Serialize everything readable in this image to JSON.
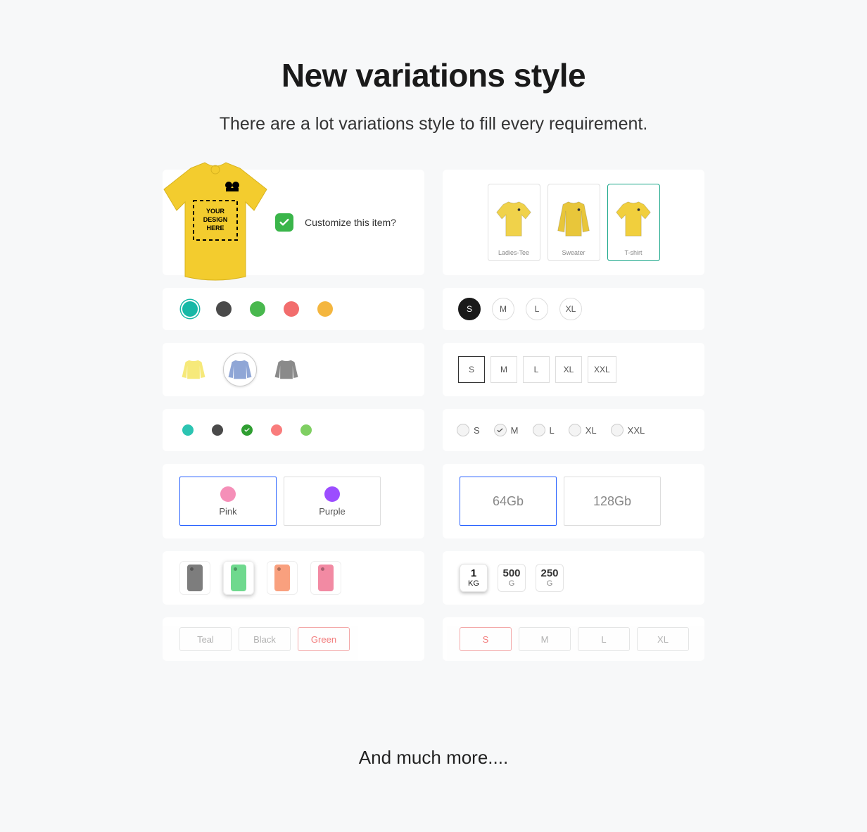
{
  "title": "New variations style",
  "subtitle": "There are a lot variations style to fill every requirement.",
  "footer": "And much more....",
  "customize": {
    "label": "Customize this item?",
    "tshirt_placeholder_line1": "YOUR",
    "tshirt_placeholder_line2": "DESIGN",
    "tshirt_placeholder_line3": "HERE"
  },
  "products": [
    {
      "label": "Ladies-Tee",
      "selected": false,
      "color": "#f0d24a",
      "type": "tee"
    },
    {
      "label": "Sweater",
      "selected": false,
      "color": "#e8c63a",
      "type": "sweater"
    },
    {
      "label": "T-shirt",
      "selected": true,
      "color": "#f1cf3d",
      "type": "tee"
    }
  ],
  "color_dots": {
    "selected_index": 0,
    "items": [
      "#17b8a6",
      "#4a4a4a",
      "#49b84e",
      "#f26d6d",
      "#f4b63f"
    ]
  },
  "sweater_thumbs": {
    "selected_index": 1,
    "items": [
      "#f6e97a",
      "#8fa6d6",
      "#8a8a8a"
    ]
  },
  "small_dots": {
    "checked_index": 2,
    "items": [
      "#2cc4b2",
      "#4a4a4a",
      "#2f9e31",
      "#f97c7c",
      "#7fcf62"
    ]
  },
  "sizes_circle": {
    "selected_index": 0,
    "items": [
      "S",
      "M",
      "L",
      "XL"
    ]
  },
  "sizes_square": {
    "selected_index": 0,
    "items": [
      "S",
      "M",
      "L",
      "XL",
      "XXL"
    ]
  },
  "sizes_radio": {
    "checked_index": 1,
    "items": [
      "S",
      "M",
      "L",
      "XL",
      "XXL"
    ]
  },
  "box_swatches": {
    "selected_index": 0,
    "items": [
      {
        "label": "Pink",
        "color": "#f58fb8"
      },
      {
        "label": "Purple",
        "color": "#9c4dff"
      }
    ]
  },
  "storage": {
    "selected_index": 0,
    "items": [
      "64Gb",
      "128Gb"
    ]
  },
  "cases": {
    "selected_index": 1,
    "items": [
      "#7d7d7d",
      "#6fd98e",
      "#f9a07e",
      "#f28aa3"
    ]
  },
  "weights": {
    "selected_index": 0,
    "items": [
      {
        "top": "1",
        "bottom": "KG"
      },
      {
        "top": "500",
        "bottom": "G"
      },
      {
        "top": "250",
        "bottom": "G"
      }
    ]
  },
  "text_chips_left": {
    "selected_index": 2,
    "items": [
      "Teal",
      "Black",
      "Green"
    ]
  },
  "text_chips_right": {
    "selected_index": 0,
    "items": [
      "S",
      "M",
      "L",
      "XL"
    ]
  }
}
